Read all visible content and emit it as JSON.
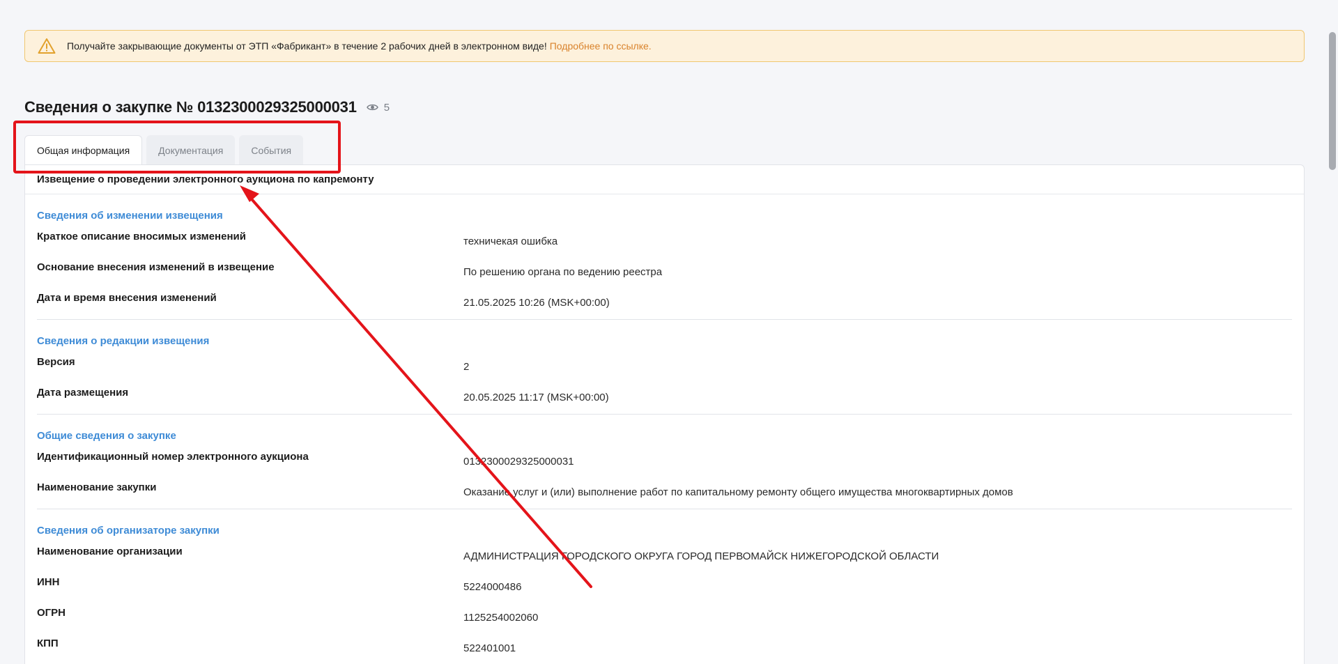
{
  "notice": {
    "text": "Получайте закрывающие документы от ЭТП «Фабрикант» в течение 2 рабочих дней в электронном виде!",
    "link": "Подробнее по ссылке.",
    "icon": "warning-icon",
    "accent": "#d9822b"
  },
  "header": {
    "title": "Сведения о закупке № 0132300029325000031",
    "views": "5"
  },
  "tabs": [
    {
      "label": "Общая информация",
      "active": true
    },
    {
      "label": "Документация",
      "active": false
    },
    {
      "label": "События",
      "active": false
    }
  ],
  "content": {
    "heading": "Извещение о проведении электронного аукциона по капремонту",
    "sections": [
      {
        "title": "Сведения об изменении извещения",
        "rows": [
          {
            "label": "Краткое описание вносимых изменений",
            "value": "техничекая ошибка"
          },
          {
            "label": "Основание внесения изменений в извещение",
            "value": "По решению органа по ведению реестра"
          },
          {
            "label": "Дата и время внесения изменений",
            "value": "21.05.2025 10:26 (MSK+00:00)"
          }
        ]
      },
      {
        "title": "Сведения о редакции извещения",
        "rows": [
          {
            "label": "Версия",
            "value": "2"
          },
          {
            "label": "Дата размещения",
            "value": "20.05.2025 11:17 (MSK+00:00)"
          }
        ]
      },
      {
        "title": "Общие сведения о закупке",
        "rows": [
          {
            "label": "Идентификационный номер электронного аукциона",
            "value": "0132300029325000031"
          },
          {
            "label": "Наименование закупки",
            "value": "Оказание услуг и (или) выполнение работ по капитальному ремонту общего имущества многоквартирных домов"
          }
        ]
      },
      {
        "title": "Сведения об организаторе закупки",
        "rows": [
          {
            "label": "Наименование организации",
            "value": "АДМИНИСТРАЦИЯ ГОРОДСКОГО ОКРУГА ГОРОД ПЕРВОМАЙСК НИЖЕГОРОДСКОЙ ОБЛАСТИ"
          },
          {
            "label": "ИНН",
            "value": "5224000486"
          },
          {
            "label": "ОГРН",
            "value": "1125254002060"
          },
          {
            "label": "КПП",
            "value": "522401001"
          }
        ]
      }
    ]
  },
  "annotation": {
    "color": "#e4141a"
  }
}
